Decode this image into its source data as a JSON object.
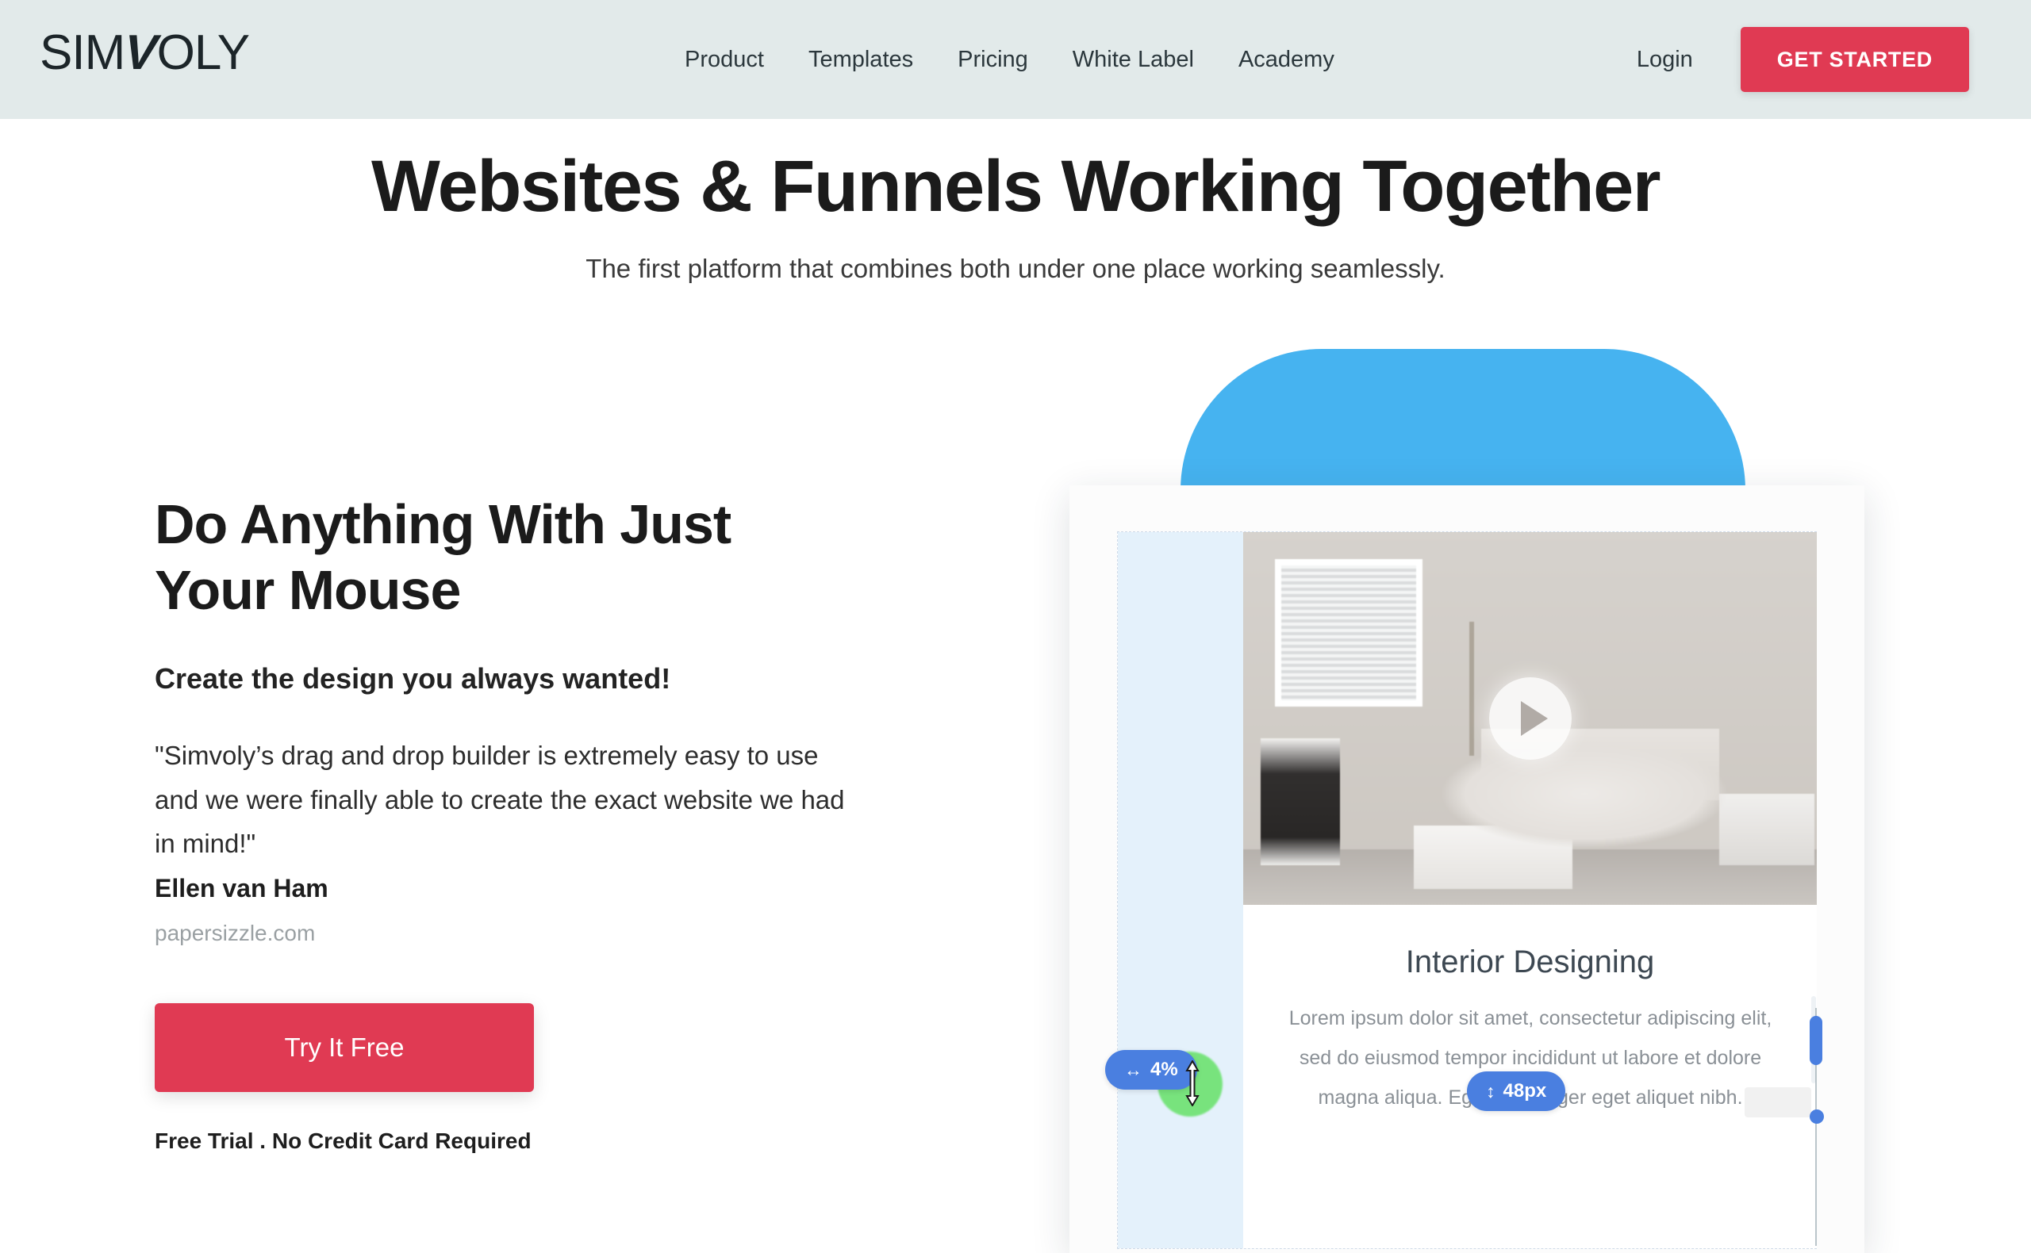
{
  "header": {
    "logo": {
      "part1": "SIM",
      "part2": "V",
      "part3": "OLY"
    },
    "nav": [
      {
        "label": "Product"
      },
      {
        "label": "Templates"
      },
      {
        "label": "Pricing"
      },
      {
        "label": "White Label"
      },
      {
        "label": "Academy"
      }
    ],
    "login_label": "Login",
    "cta_label": "GET STARTED",
    "background": "#e2eaea",
    "accent": "#e03a53"
  },
  "hero": {
    "title": "Websites & Funnels Working Together",
    "subtitle": "The first platform that combines both under one place working seamlessly."
  },
  "left": {
    "title": "Do Anything With Just Your Mouse",
    "tagline": "Create the design you always wanted!",
    "quote": "\"Simvoly’s drag and drop builder is extremely easy to use and we were finally able to create the exact website we had in mind!\"",
    "author": "Ellen van Ham",
    "website": "papersizzle.com",
    "cta_label": "Try It Free",
    "note": "Free Trial . No Credit Card Required"
  },
  "mockup": {
    "dome_color": "#46b3f0",
    "badge_width": {
      "icon": "↔",
      "value": "4%"
    },
    "badge_height": {
      "icon": "↕",
      "value": "48px"
    },
    "block": {
      "title": "Interior Designing",
      "body": "Lorem ipsum dolor sit amet, consectetur adipiscing elit, sed do eiusmod tempor incididunt ut labore et dolore magna aliqua. Egestas integer eget aliquet nibh."
    },
    "handle_color": "#4a7fe0",
    "cursor_highlight_color": "#5ae05a"
  }
}
